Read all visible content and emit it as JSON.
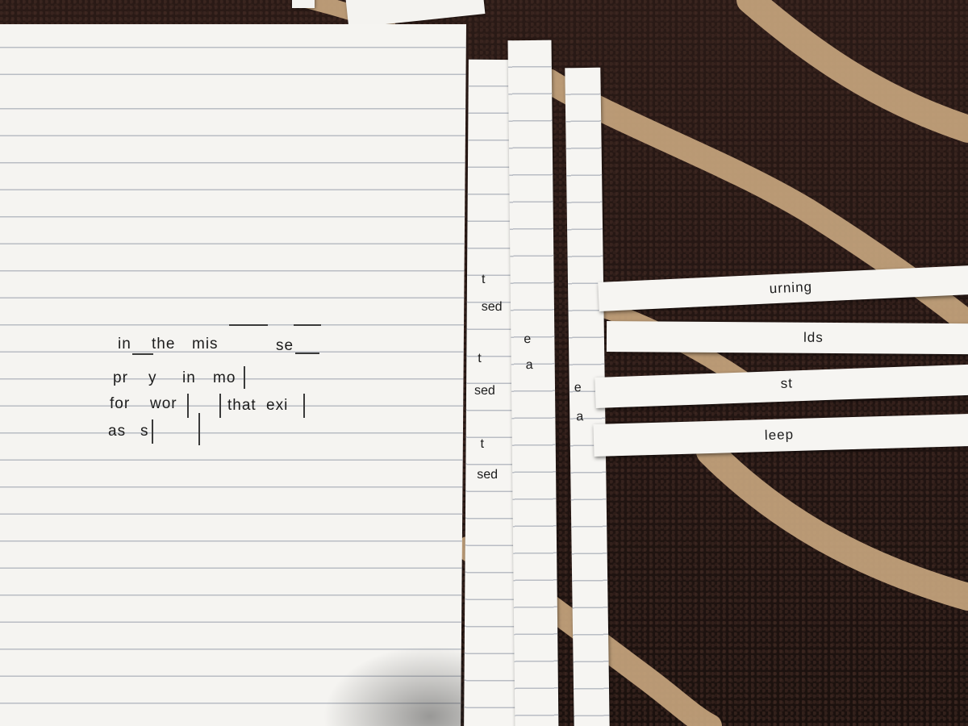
{
  "sheet": {
    "lines": [
      {
        "parts": [
          "in",
          "the",
          "mis",
          "se"
        ]
      },
      {
        "parts": [
          "pr",
          "y",
          "in",
          "mo"
        ]
      },
      {
        "parts": [
          "for",
          "wor",
          "that",
          "exi"
        ]
      },
      {
        "parts": [
          "as",
          "s"
        ]
      }
    ]
  },
  "vertical_strips": [
    {
      "letters": [
        "t",
        "sed",
        "t",
        "sed",
        "t",
        "sed"
      ]
    },
    {
      "letters": [
        "e",
        "a"
      ]
    },
    {
      "letters": [
        "e",
        "a"
      ]
    }
  ],
  "horizontal_strips": [
    {
      "word": "urning"
    },
    {
      "word": "lds"
    },
    {
      "word": "st"
    },
    {
      "word": "leep"
    }
  ]
}
